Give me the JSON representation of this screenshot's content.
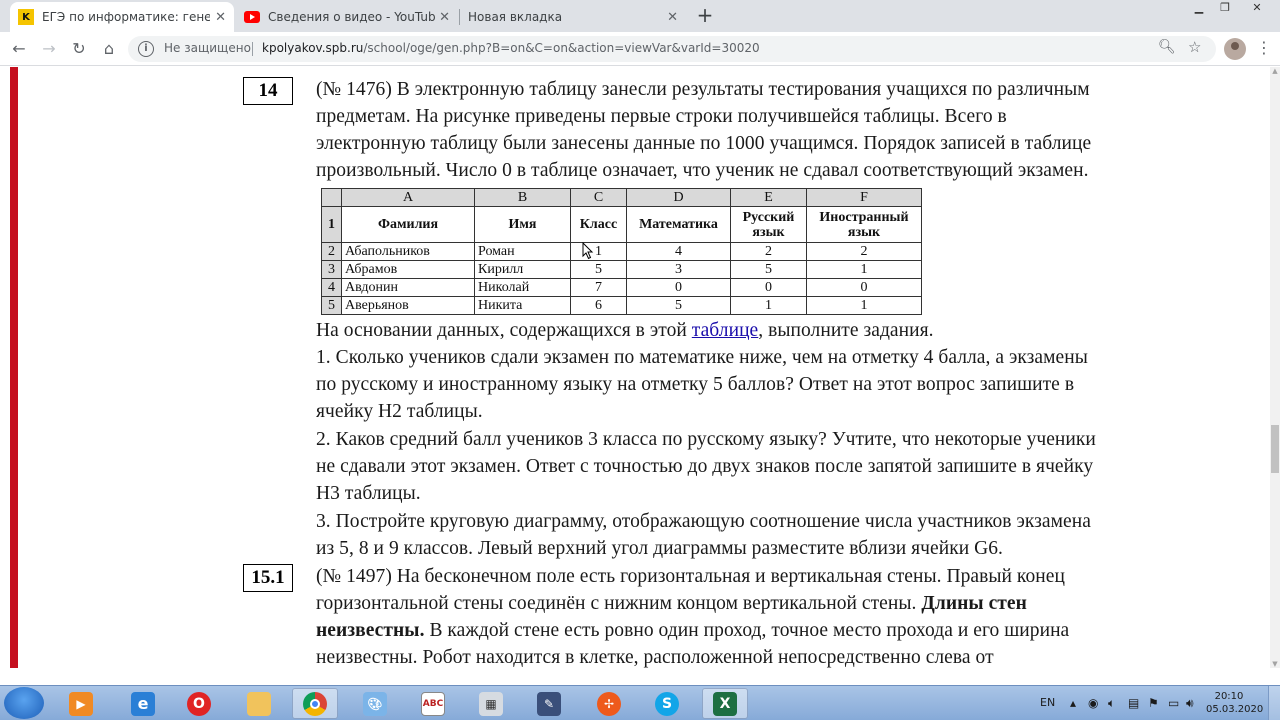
{
  "browser": {
    "tabs": [
      {
        "title": "ЕГЭ по информатике: генератор",
        "icon": "kpolyakov-favicon-icon"
      },
      {
        "title": "Сведения о видео - YouTube St",
        "icon": "youtube-favicon-icon"
      },
      {
        "title": "Новая вкладка",
        "icon": ""
      }
    ],
    "security_label": "Не защищено",
    "url_host": "kpolyakov.spb.ru",
    "url_path": "/school/oge/gen.php?B=on&C=on&action=viewVar&varId=30020"
  },
  "task14": {
    "number": "14",
    "lines": [
      "(№ 1476) В электронную таблицу занесли результаты тестирования учащихся по различным",
      "предметам. На рисунке приведены первые строки получившейся таблицы. Всего в",
      "электронную таблицу были занесены данные по 1000 учащимся. Порядок записей в таблице",
      "произвольный. Число 0 в таблице означает, что ученик не сдавал соответствующий экзамен."
    ],
    "table": {
      "columns": [
        "A",
        "B",
        "C",
        "D",
        "E",
        "F"
      ],
      "row_numbers": [
        "1",
        "2",
        "3",
        "4",
        "5"
      ],
      "headers": [
        "Фамилия",
        "Имя",
        "Класс",
        "Математика",
        "Русский язык",
        "Иностранный язык"
      ],
      "rows": [
        [
          "Абапольников",
          "Роман",
          "1",
          "4",
          "2",
          "2"
        ],
        [
          "Абрамов",
          "Кирилл",
          "5",
          "3",
          "5",
          "1"
        ],
        [
          "Авдонин",
          "Николай",
          "7",
          "0",
          "0",
          "0"
        ],
        [
          "Аверьянов",
          "Никита",
          "6",
          "5",
          "1",
          "1"
        ]
      ]
    },
    "after_table_before_link": "На основании данных, содержащихся в этой ",
    "link_text": "таблице",
    "after_link": ", выполните задания.",
    "q1": [
      "1. Сколько учеников сдали экзамен по математике ниже, чем на отметку 4 балла, а экзамены",
      "по русскому и иностранному языку на отметку 5 баллов? Ответ на этот вопрос запишите в",
      "ячейку H2 таблицы."
    ],
    "q2": [
      "2. Каков средний балл учеников 3 класса по русскому языку? Учтите, что некоторые ученики",
      "не сдавали этот экзамен. Ответ с точностью до двух знаков после запятой запишите в ячейку",
      "H3 таблицы."
    ],
    "q3": [
      "3. Постройте круговую диаграмму, отображающую соотношение числа участников экзамена",
      "из 5, 8 и 9 классов. Левый верхний угол диаграммы разместите вблизи ячейки G6."
    ]
  },
  "task15": {
    "number": "15.1",
    "line1": "(№ 1497) На бесконечном поле есть горизонтальная и вертикальная стены. Правый конец",
    "line2_plain": "горизонтальной стены соединён с нижним концом вертикальной стены. ",
    "line2_bold": "Длины стен",
    "line3_bold": "неизвестны.",
    "line3_plain": " В каждой стене есть ровно один проход, точное место прохода и его ширина",
    "line4": "неизвестны. Робот находится в клетке, расположенной непосредственно слева от"
  },
  "taskbar": {
    "language": "EN",
    "time": "20:10",
    "date": "05.03.2020",
    "apps": [
      "windows-media-player-icon",
      "internet-explorer-icon",
      "opera-icon",
      "file-explorer-icon",
      "chrome-icon",
      "paint-icon",
      "abc-net-icon",
      "calculator-icon",
      "draw-icon",
      "pinwheel-icon",
      "skype-icon",
      "excel-icon"
    ]
  }
}
